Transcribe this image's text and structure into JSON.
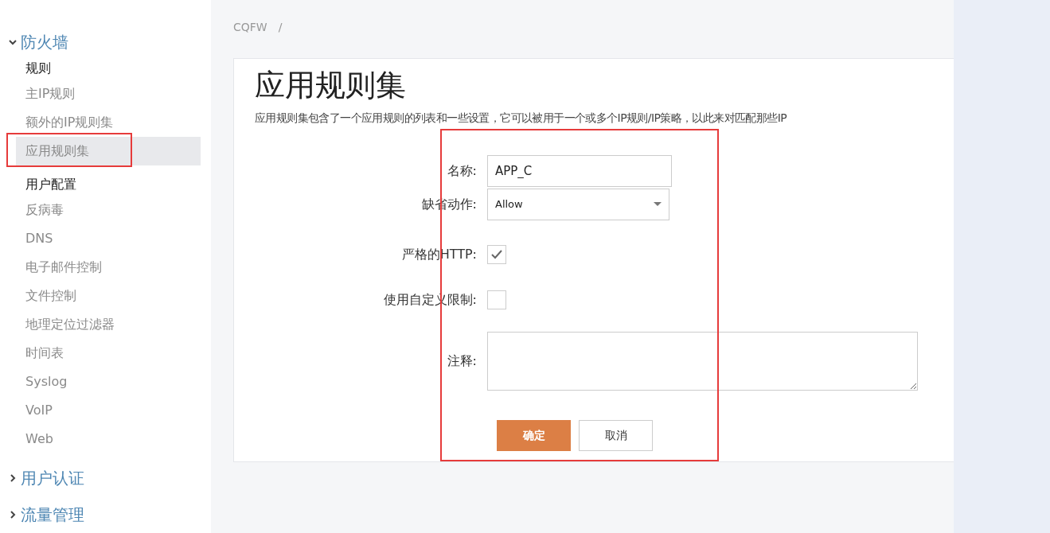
{
  "sidebar": {
    "groups": [
      {
        "label": "防火墙",
        "expanded": true,
        "items": [
          {
            "kind": "heading",
            "label": "规则"
          },
          {
            "kind": "link",
            "label": "主IP规则",
            "selected": false
          },
          {
            "kind": "link",
            "label": "额外的IP规则集",
            "selected": false
          },
          {
            "kind": "link",
            "label": "应用规则集",
            "selected": true
          },
          {
            "kind": "heading",
            "label": "用户配置"
          },
          {
            "kind": "link",
            "label": "反病毒",
            "selected": false
          },
          {
            "kind": "link",
            "label": "DNS",
            "selected": false
          },
          {
            "kind": "link",
            "label": "电子邮件控制",
            "selected": false
          },
          {
            "kind": "link",
            "label": "文件控制",
            "selected": false
          },
          {
            "kind": "link",
            "label": "地理定位过滤器",
            "selected": false
          },
          {
            "kind": "link",
            "label": "时间表",
            "selected": false
          },
          {
            "kind": "link",
            "label": "Syslog",
            "selected": false
          },
          {
            "kind": "link",
            "label": "VoIP",
            "selected": false
          },
          {
            "kind": "link",
            "label": "Web",
            "selected": false
          }
        ]
      },
      {
        "label": "用户认证",
        "expanded": false
      },
      {
        "label": "流量管理",
        "expanded": false
      }
    ]
  },
  "breadcrumb": {
    "items": [
      "CQFW"
    ],
    "separator": "/"
  },
  "page": {
    "title": "应用规则集",
    "description": "应用规则集包含了一个应用规则的列表和一些设置，它可以被用于一个或多个IP规则/IP策略，以此来对匹配那些IP"
  },
  "form": {
    "fields": [
      {
        "kind": "text",
        "label": "名称:",
        "value": "APP_C"
      },
      {
        "kind": "select",
        "label": "缺省动作:",
        "value": "Allow"
      },
      {
        "kind": "checkbox",
        "label": "严格的HTTP:",
        "checked": true
      },
      {
        "kind": "checkbox",
        "label": "使用自定义限制:",
        "checked": false
      },
      {
        "kind": "textarea",
        "label": "注释:"
      }
    ],
    "buttons": [
      {
        "label": "确定",
        "primary": true
      },
      {
        "label": "取消",
        "primary": false
      }
    ]
  }
}
